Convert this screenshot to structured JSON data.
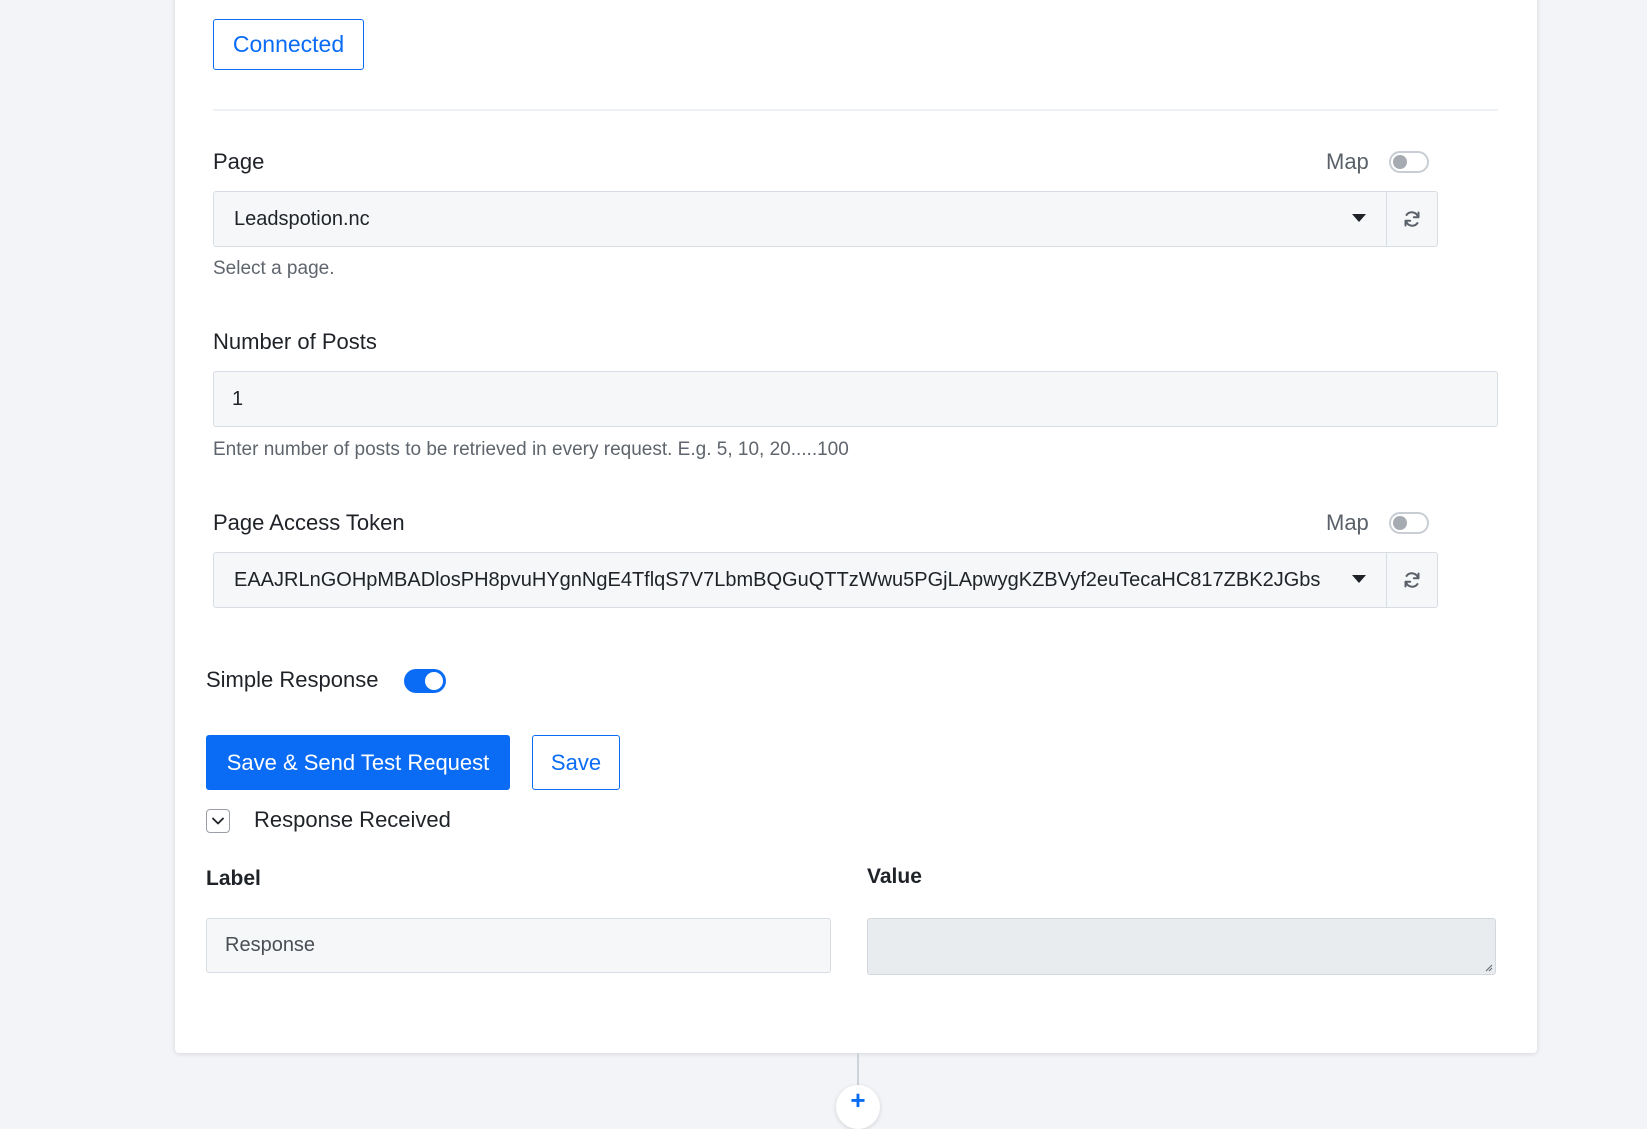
{
  "connection": {
    "status_label": "Connected"
  },
  "page_field": {
    "label": "Page",
    "map_label": "Map",
    "map_enabled": false,
    "selected_value": "Leadspotion.nc",
    "help": "Select a page."
  },
  "posts_field": {
    "label": "Number of Posts",
    "value": "1",
    "help": "Enter number of posts to be retrieved in every request. E.g. 5, 10, 20.....100"
  },
  "token_field": {
    "label": "Page Access Token",
    "map_label": "Map",
    "map_enabled": false,
    "selected_value": "EAAJRLnGOHpMBADlosPH8pvuHYgnNgE4TflqS7V7LbmBQGuQTTzWwu5PGjLApwygKZBVyf2euTecaHC817ZBK2JGbs"
  },
  "simple_response": {
    "label": "Simple Response",
    "enabled": true
  },
  "actions": {
    "send_test_label": "Save & Send Test Request",
    "save_label": "Save"
  },
  "response_section": {
    "title": "Response Received",
    "expanded": true,
    "label_header": "Label",
    "value_header": "Value",
    "rows": [
      {
        "label": "Response",
        "value": ""
      }
    ]
  },
  "colors": {
    "accent": "#0a6cf5",
    "background": "#f2f4f7",
    "input_bg": "#f5f7f9"
  },
  "icons": {
    "refresh": "refresh-icon",
    "caret": "caret-down-icon",
    "chevron": "chevron-down-icon",
    "add": "plus-icon"
  }
}
